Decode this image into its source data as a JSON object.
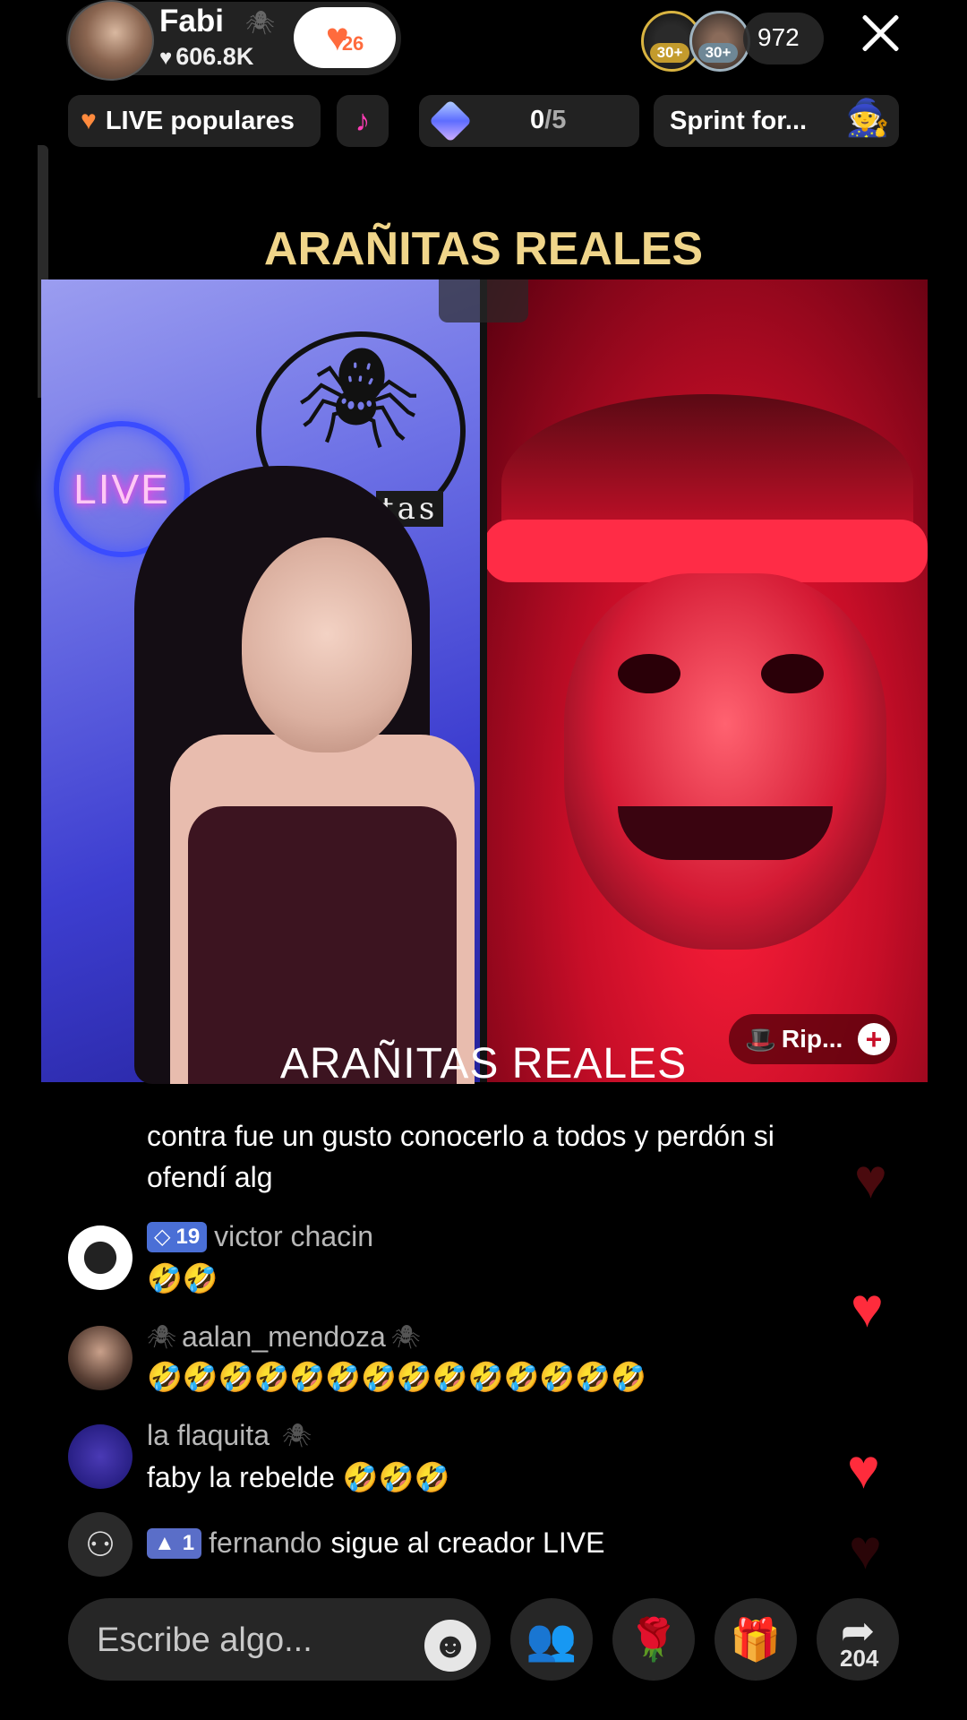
{
  "host": {
    "name": "Fabi",
    "likes": "606.8K",
    "follow_level": "26"
  },
  "viewers": {
    "rank_a": "30+",
    "rank_b": "30+",
    "count": "972"
  },
  "pills": {
    "popular": "LIVE populares",
    "goal_current": "0",
    "goal_total": "/5",
    "sprint": "Sprint for..."
  },
  "stream": {
    "title": "ARAÑITAS REALES",
    "neon_sign": "LIVE",
    "logo_text": "tas",
    "watermark": "ARAÑITAS REALES",
    "guest_label": "Rip..."
  },
  "chat": {
    "partial_top": "contra fue un gusto conocerlo a todos y perdón si",
    "partial_bottom": "ofendí alg",
    "messages": [
      {
        "level": "19",
        "name": "victor chacin",
        "text": "🤣🤣"
      },
      {
        "name": "aalan_mendoza",
        "text": "🤣🤣🤣🤣🤣🤣🤣🤣🤣🤣🤣🤣🤣🤣"
      },
      {
        "name": "la flaquita",
        "text": "faby la rebelde 🤣🤣🤣"
      }
    ],
    "system": {
      "level": "1",
      "name": "fernando",
      "text": "sigue al creador LIVE"
    }
  },
  "input": {
    "placeholder": "Escribe algo..."
  },
  "share": {
    "count": "204"
  },
  "icons": {
    "close": "close-icon",
    "music": "music-note-icon",
    "gem": "gem-icon",
    "emoji": "emoji-icon",
    "guests": "multi-guest-icon",
    "rose": "rose-gift-icon",
    "gift": "gift-box-icon",
    "share": "share-arrow-icon"
  },
  "colors": {
    "title_gold": "#f0d58a",
    "heart_red": "#ff2c3c",
    "badge_blue": "#4a6fd6"
  }
}
